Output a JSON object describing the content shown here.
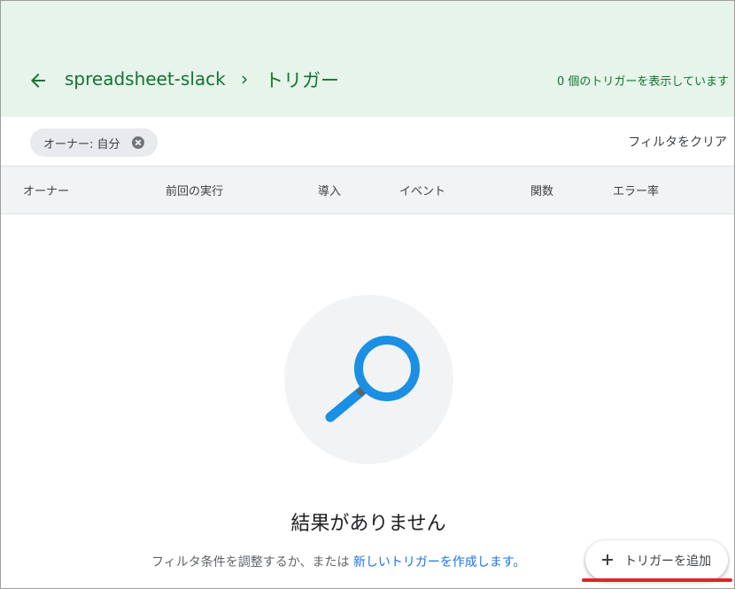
{
  "header": {
    "project_name": "spreadsheet-slack",
    "page_title": "トリガー",
    "trigger_count_text": "0 個のトリガーを表示しています"
  },
  "filter": {
    "chip_label": "オーナー: 自分",
    "clear_label": "フィルタをクリア"
  },
  "table": {
    "columns": [
      "オーナー",
      "前回の実行",
      "導入",
      "イベント",
      "関数",
      "エラー率"
    ]
  },
  "empty_state": {
    "title": "結果がありません",
    "text_prefix": "フィルタ条件を調整するか、または",
    "link_text": "新しいトリガーを作成します。"
  },
  "add_button": {
    "label": "トリガーを追加"
  },
  "colors": {
    "header_bg": "#e6f4ea",
    "accent_green": "#137333",
    "link_blue": "#1a73e8",
    "magnifier_blue": "#1a8fe3",
    "underline_red": "#e0242b"
  }
}
